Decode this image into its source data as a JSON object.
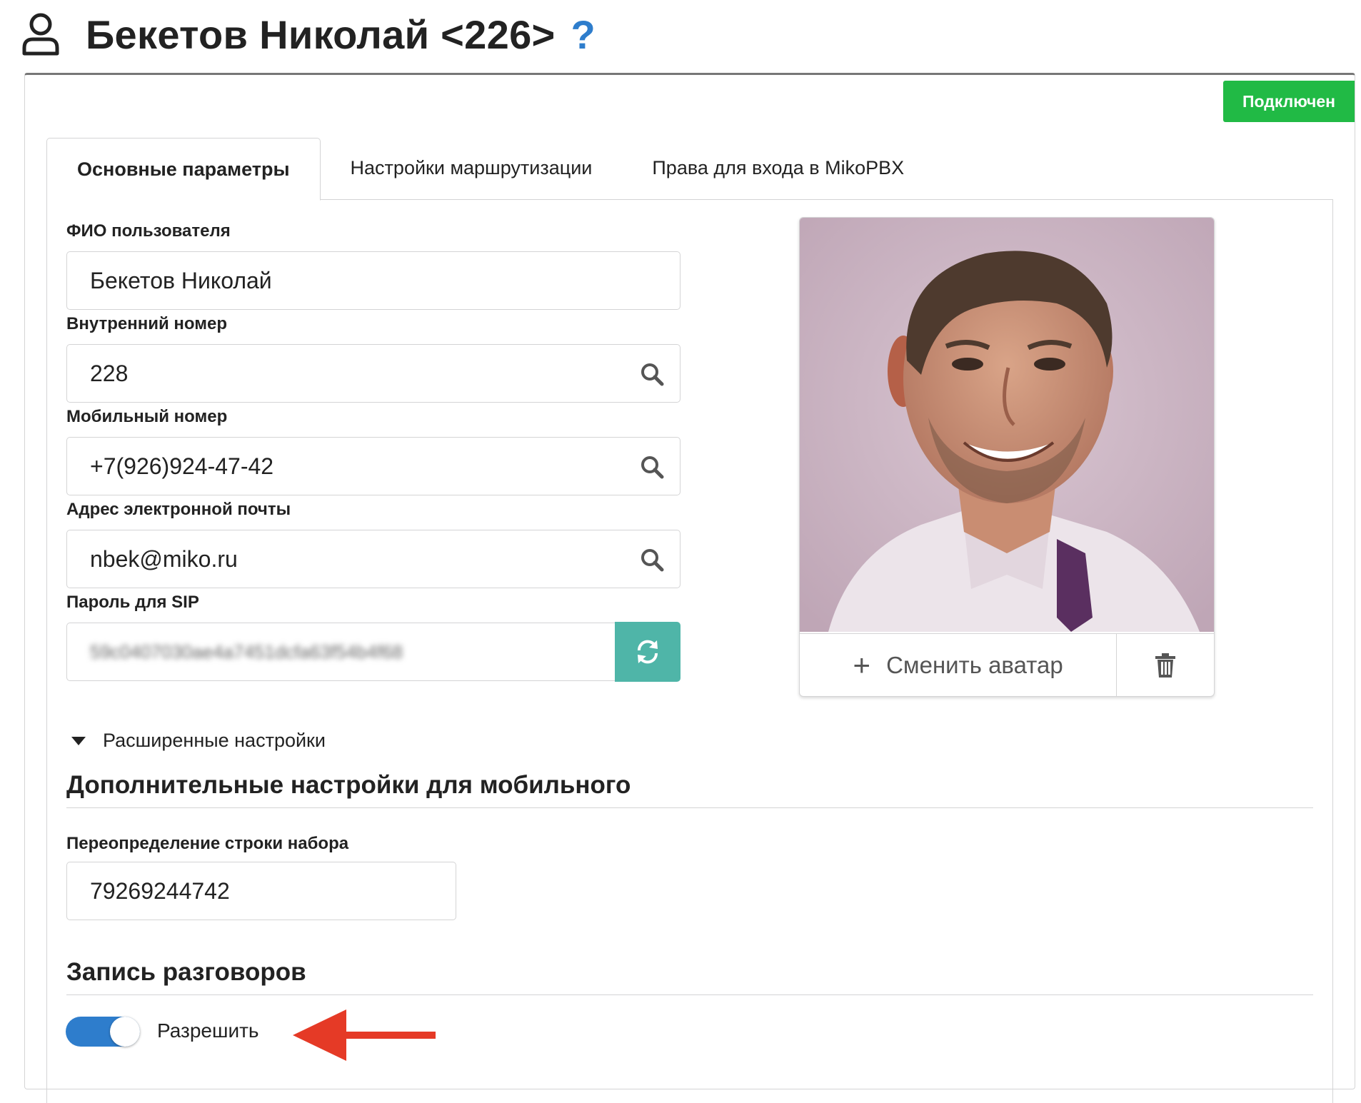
{
  "header": {
    "title": "Бекетов Николай <226>",
    "help": "?"
  },
  "status": {
    "label": "Подключен",
    "color": "#21ba45"
  },
  "tabs": [
    {
      "label": "Основные параметры",
      "active": true
    },
    {
      "label": "Настройки маршрутизации",
      "active": false
    },
    {
      "label": "Права для входа в MikoPBX",
      "active": false
    }
  ],
  "form": {
    "fio_label": "ФИО пользователя",
    "fio_value": "Бекетов Николай",
    "ext_label": "Внутренний номер",
    "ext_value": "228",
    "mobile_label": "Мобильный номер",
    "mobile_value": "+7(926)924-47-42",
    "email_label": "Адрес электронной почты",
    "email_value": "nbek@miko.ru",
    "sip_label": "Пароль для SIP",
    "sip_value": "59c0407030ae4a7451dcfa63f54b4f68"
  },
  "avatar": {
    "change_label": "Сменить аватар",
    "add_icon": "plus-icon",
    "delete_icon": "trash-icon"
  },
  "advanced": {
    "label": "Расширенные настройки"
  },
  "mobile_section": {
    "title": "Дополнительные настройки для мобильного",
    "dialstring_label": "Переопределение строки набора",
    "dialstring_value": "79269244742"
  },
  "recording_section": {
    "title": "Запись разговоров",
    "toggle_label": "Разрешить",
    "toggle_on": true,
    "toggle_color": "#2e7dcc"
  },
  "annotation": {
    "arrow_color": "#e53a26"
  },
  "colors": {
    "generate_button": "#4fb5a8",
    "help": "#2e7dcc"
  }
}
